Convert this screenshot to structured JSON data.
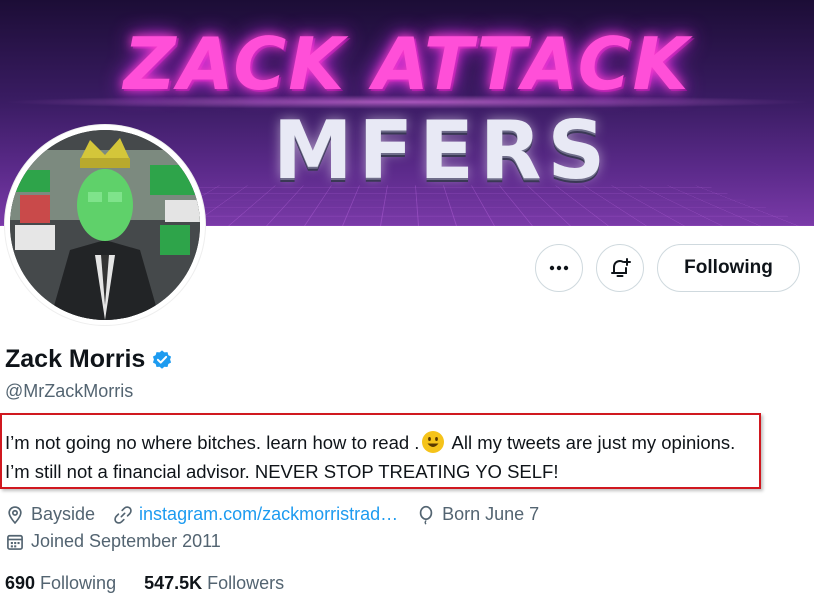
{
  "banner": {
    "line1": "ZACK ATTACK",
    "line2": "MFERS"
  },
  "actions": {
    "following_label": "Following"
  },
  "profile": {
    "name": "Zack Morris",
    "handle": "@MrZackMorris",
    "bio_part1": "I’m not going no where bitches. learn how to read .",
    "bio_part2": " All my tweets are just my opinions. I’m still not a financial advisor. NEVER STOP TREATING YO SELF!",
    "location": "Bayside",
    "website": "instagram.com/zackmorristrad…",
    "birthday": "Born June 7",
    "joined": "Joined September 2011"
  },
  "stats": {
    "following_count": "690",
    "following_label": "Following",
    "followers_count": "547.5K",
    "followers_label": "Followers"
  },
  "colors": {
    "accent": "#1d9bf0",
    "highlight_box": "#d0181f",
    "verified": "#1d9bf0"
  },
  "icons": [
    "more-icon",
    "notification-bell-icon",
    "verified-badge-icon",
    "location-icon",
    "link-icon",
    "balloon-icon",
    "calendar-icon"
  ]
}
